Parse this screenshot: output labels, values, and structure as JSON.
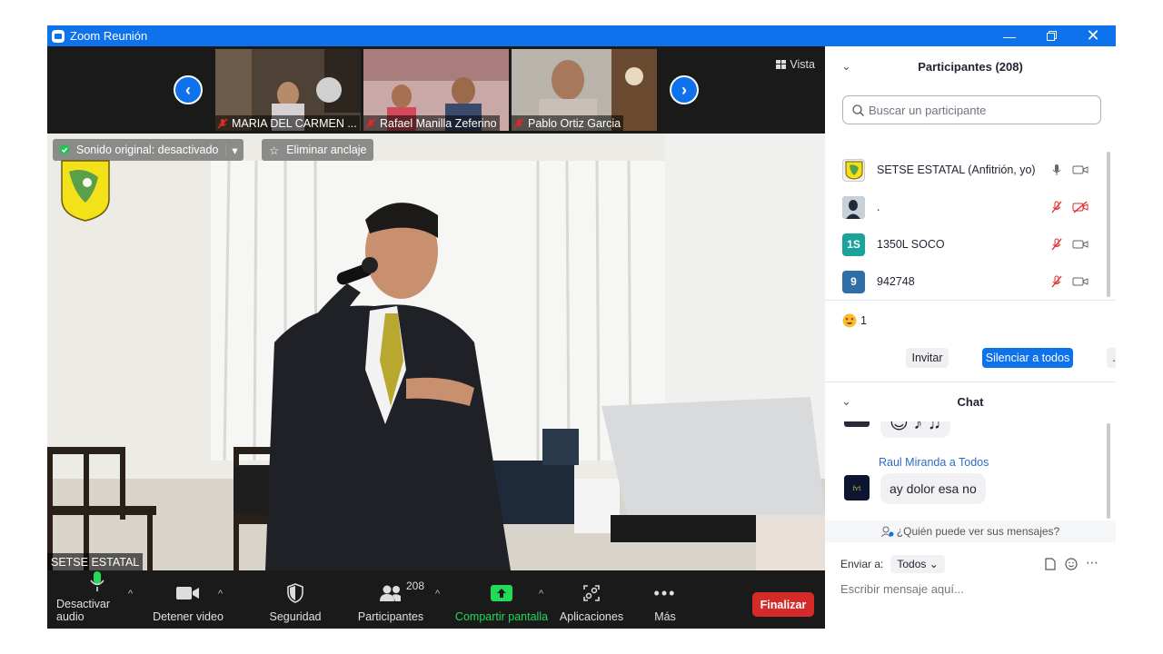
{
  "window": {
    "title": "Zoom Reunión"
  },
  "gallery": {
    "thumbnails": [
      {
        "name": "MARIA DEL CARMEN ...",
        "muted": true
      },
      {
        "name": "Rafael Manilla Zeferino",
        "muted": true
      },
      {
        "name": "Pablo Ortiz Garcia",
        "muted": true
      }
    ],
    "view_label": "Vista"
  },
  "main_video": {
    "original_sound": "Sonido original: desactivado",
    "unpin": "Eliminar anclaje",
    "speaker": "SETSE ESTATAL"
  },
  "toolbar": {
    "audio": "Desactivar audio",
    "video": "Detener video",
    "security": "Seguridad",
    "participants": "Participantes",
    "participants_count": "208",
    "share": "Compartir pantalla",
    "apps": "Aplicaciones",
    "more": "Más",
    "end": "Finalizar"
  },
  "participants_panel": {
    "title": "Participantes (208)",
    "search_placeholder": "Buscar un participante",
    "list": [
      {
        "name": "SETSE ESTATAL (Anfitrión, yo)",
        "avatar": "",
        "color": "#f5f5f0",
        "mic": "on",
        "cam": "off"
      },
      {
        "name": ".",
        "avatar": "",
        "color": "#3d4a5a",
        "mic": "muted",
        "cam": "muted"
      },
      {
        "name": "1350L SOCO",
        "avatar": "1S",
        "color": "#1aa39a",
        "mic": "muted",
        "cam": "off"
      },
      {
        "name": "942748",
        "avatar": "9",
        "color": "#2f6fa8",
        "mic": "muted",
        "cam": "off"
      }
    ],
    "reaction_count": "1",
    "invite": "Invitar",
    "mute_all": "Silenciar a todos",
    "more": "..."
  },
  "chat": {
    "title": "Chat",
    "partial_message": "😊 ♪ ♫",
    "sender": "Raul Miranda a Todos",
    "message": "ay dolor esa no",
    "who_can_see": "¿Quién puede ver sus mensajes?",
    "send_to_label": "Enviar a:",
    "send_to_value": "Todos",
    "input_placeholder": "Escribir mensaje aquí..."
  },
  "colors": {
    "zoom_blue": "#0e72ed",
    "end_red": "#d42a2a",
    "share_green": "#23d959"
  }
}
